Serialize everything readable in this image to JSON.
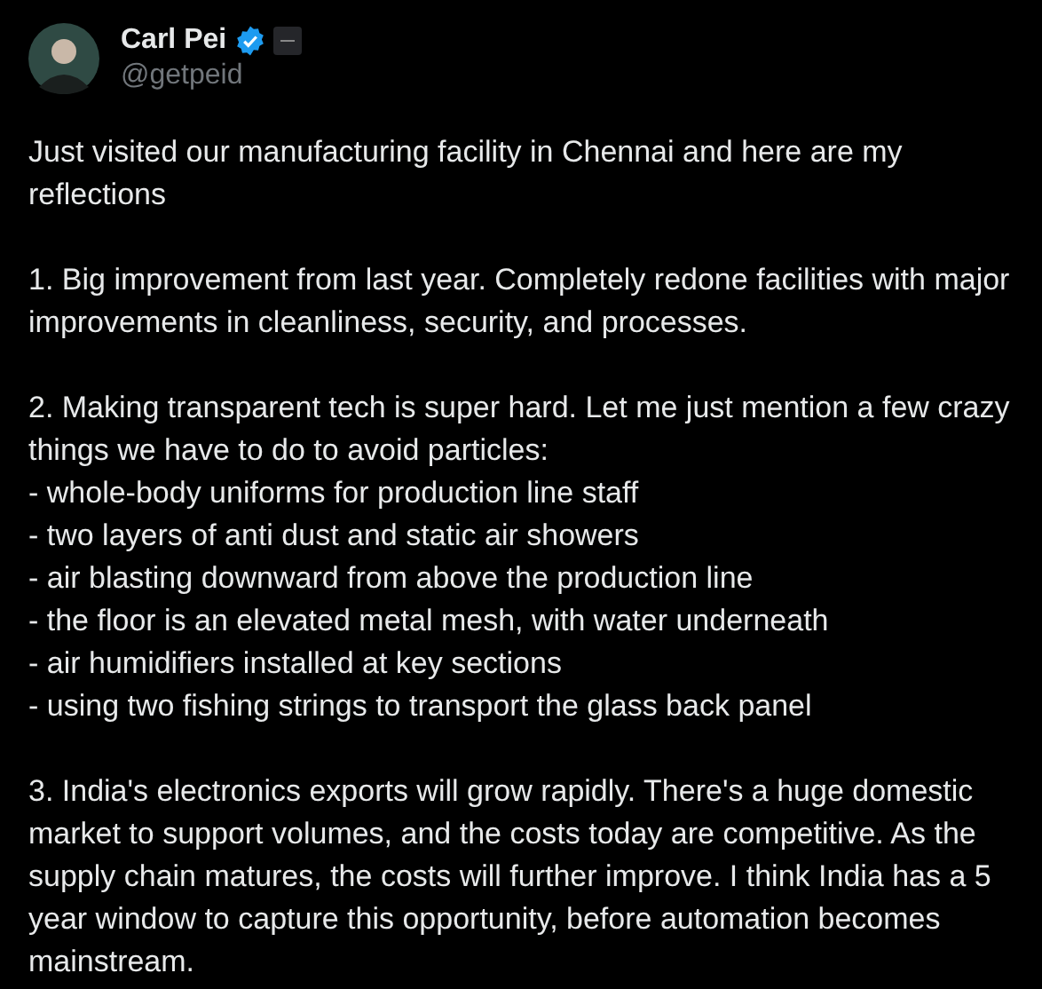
{
  "author": {
    "name": "Carl Pei",
    "handle": "@getpeid",
    "verified": true,
    "badge": true
  },
  "blocks": [
    {
      "kind": "paragraph",
      "text": "Just visited our manufacturing facility in Chennai and here are my reflections"
    },
    {
      "kind": "paragraph",
      "text": "1. Big improvement from last year. Completely redone facilities with major improvements in cleanliness, security, and processes."
    },
    {
      "kind": "paragraph",
      "text": "2. Making transparent tech is super hard. Let me just mention a few crazy things we have to do to avoid particles:"
    },
    {
      "kind": "line",
      "text": "- whole-body uniforms for production line staff"
    },
    {
      "kind": "line",
      "text": "- two layers of anti dust and static air showers"
    },
    {
      "kind": "line",
      "text": "- air blasting downward from above the production line"
    },
    {
      "kind": "line",
      "text": "- the floor is an elevated metal mesh, with water underneath"
    },
    {
      "kind": "line",
      "text": "- air humidifiers installed at key sections"
    },
    {
      "kind": "line",
      "text": "- using two fishing strings to transport the glass back panel"
    },
    {
      "kind": "paragraph",
      "text": "3. India's electronics exports will grow rapidly. There's a huge domestic market to support volumes, and the costs today are competitive. As the supply chain matures, the costs will further improve. I think India has a 5 year window to capture this opportunity, before automation becomes mainstream."
    }
  ]
}
